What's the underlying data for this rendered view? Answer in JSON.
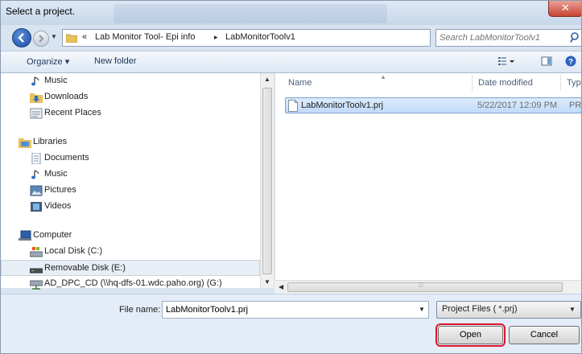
{
  "window": {
    "title": "Select a project."
  },
  "address": {
    "overflow_chevron": "«",
    "breadcrumbs": [
      "Lab Monitor Tool- Epi info",
      "LabMonitorToolv1"
    ],
    "separator": "▸",
    "search_placeholder": "Search LabMonitorToolv1"
  },
  "toolbar": {
    "organize_label": "Organize ▾",
    "new_folder_label": "New folder"
  },
  "nav": {
    "items": [
      {
        "label": "Music",
        "icon": "music-icon"
      },
      {
        "label": "Downloads",
        "icon": "downloads-folder-icon"
      },
      {
        "label": "Recent Places",
        "icon": "recent-places-icon"
      },
      {
        "label": "Libraries",
        "icon": "libraries-icon"
      },
      {
        "label": "Documents",
        "icon": "document-icon"
      },
      {
        "label": "Music",
        "icon": "music-icon"
      },
      {
        "label": "Pictures",
        "icon": "pictures-icon"
      },
      {
        "label": "Videos",
        "icon": "video-icon"
      },
      {
        "label": "Computer",
        "icon": "computer-icon"
      },
      {
        "label": "Local Disk (C:)",
        "icon": "local-disk-icon"
      },
      {
        "label": "Removable Disk (E:)",
        "icon": "removable-disk-icon"
      },
      {
        "label": "AD_DPC_CD (\\\\hq-dfs-01.wdc.paho.org) (G:)",
        "icon": "network-drive-icon"
      }
    ],
    "selected_index": 10
  },
  "files": {
    "columns": {
      "name": "Name",
      "date": "Date modified",
      "type": "Type"
    },
    "rows": [
      {
        "name": "LabMonitorToolv1.prj",
        "date": "5/22/2017 12:09 PM",
        "type": "PRJ F"
      }
    ]
  },
  "footer": {
    "file_name_label": "File name:",
    "file_name_value": "LabMonitorToolv1.prj",
    "file_type_value": "Project Files ( *.prj)",
    "open_label": "Open",
    "cancel_label": "Cancel"
  },
  "colors": {
    "highlight": "#e0142b",
    "selection": "#cce4fb",
    "accent": "#1b4ea2"
  }
}
